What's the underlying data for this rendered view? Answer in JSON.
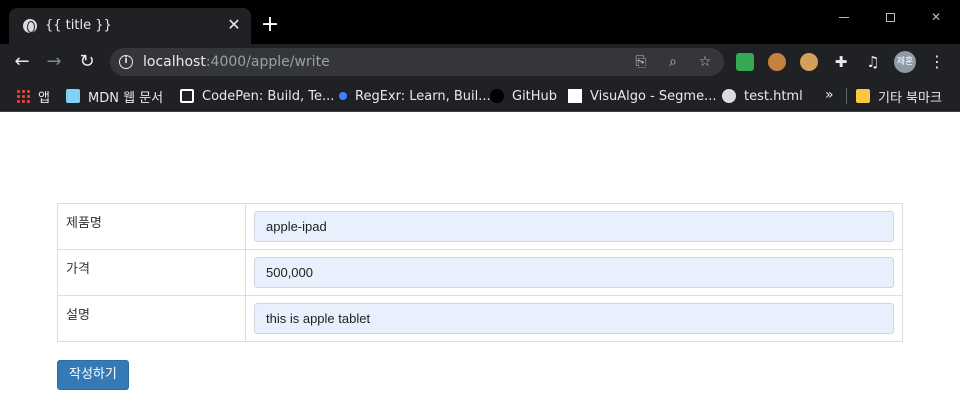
{
  "browser": {
    "tab": {
      "title": "{{ title }}",
      "close_glyph": "✕",
      "favicon": "globe-icon"
    },
    "new_tab_glyph": "+",
    "window_controls": {
      "minimize": "minimize-icon",
      "maximize": "maximize-icon",
      "close": "✕"
    },
    "toolbar": {
      "back_glyph": "←",
      "forward_glyph": "→",
      "reload_glyph": "↻",
      "url_host": "localhost",
      "url_path": ":4000/apple/write",
      "info_glyph": "i",
      "translate_glyph": "⎘",
      "zoom_glyph": "⌕",
      "star_glyph": "☆",
      "puzzle_glyph": "✚",
      "media_glyph": "♫",
      "avatar_text": "제훈",
      "menu_glyph": "⋮"
    },
    "bookmarks": [
      {
        "label": "앱",
        "icon": "apps-grid-icon"
      },
      {
        "label": "MDN 웹 문서",
        "icon": "mdn-icon"
      },
      {
        "label": "CodePen: Build, Te...",
        "icon": "codepen-icon"
      },
      {
        "label": "RegExr: Learn, Buil...",
        "icon": "regexr-icon"
      },
      {
        "label": "GitHub",
        "icon": "github-icon"
      },
      {
        "label": "VisuAlgo - Segme...",
        "icon": "visualgo-icon"
      },
      {
        "label": "test.html",
        "icon": "globe-icon"
      }
    ],
    "bookmarks_more": "»",
    "other_bookmarks": "기타 북마크"
  },
  "form": {
    "rows": [
      {
        "label": "제품명",
        "value": "apple-ipad"
      },
      {
        "label": "가격",
        "value": "500,000"
      },
      {
        "label": "설명",
        "value": "this is apple tablet"
      }
    ],
    "submit_label": "작성하기"
  }
}
